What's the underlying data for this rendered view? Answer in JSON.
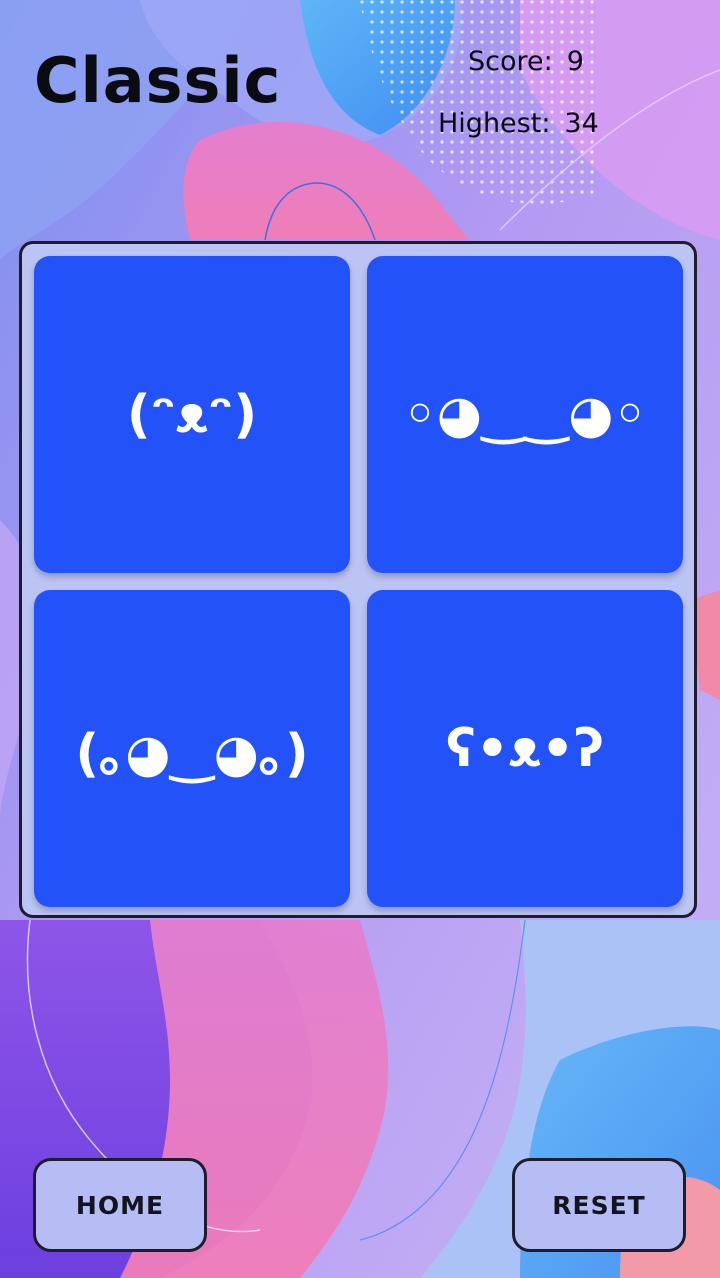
{
  "game": {
    "mode_title": "Classic",
    "score_label": "Score:",
    "score_value": "9",
    "highest_label": "Highest:",
    "highest_value": "34"
  },
  "cards": [
    {
      "face": "(ᵔᴥᵔ)"
    },
    {
      "face": "◦◕‿‿◕◦"
    },
    {
      "face": "(｡◕‿◕｡)"
    },
    {
      "face": "ʕ•ᴥ•ʔ"
    }
  ],
  "buttons": {
    "home_label": "HOME",
    "reset_label": "RESET"
  },
  "colors": {
    "card_blue": "#2352f9",
    "board_bg": "#bcc4f4",
    "button_bg": "#b6bdf4"
  }
}
